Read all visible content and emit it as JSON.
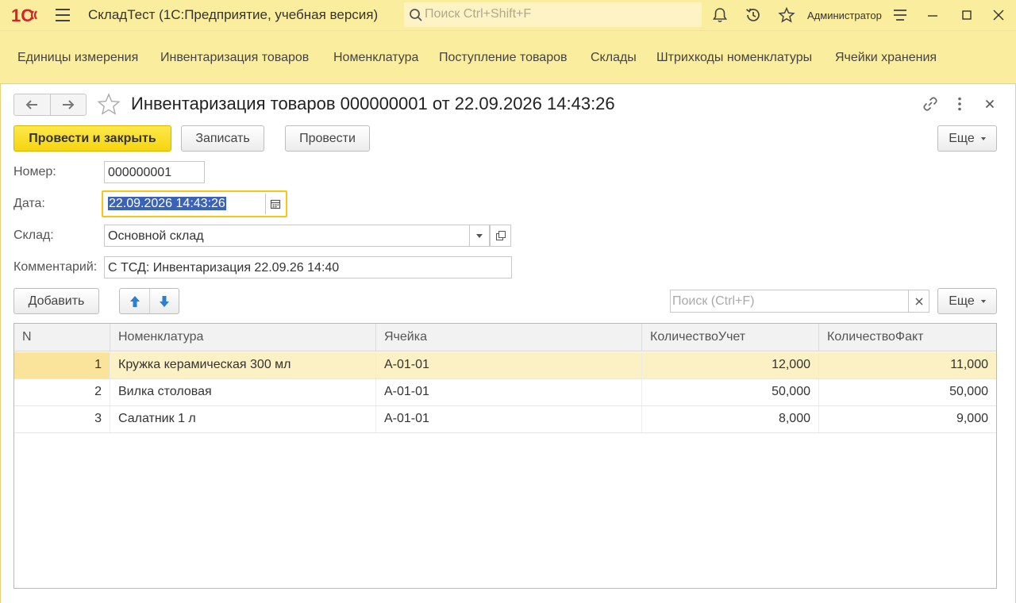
{
  "app": {
    "title": "СкладТест  (1С:Предприятие, учебная версия)",
    "search_placeholder": "Поиск Ctrl+Shift+F",
    "user": "Администратор",
    "logo_text": "1С"
  },
  "sections": [
    {
      "label": "Единицы измерения"
    },
    {
      "label": "Инвентаризация товаров"
    },
    {
      "label": "Номенклатура"
    },
    {
      "label": "Поступление товаров"
    },
    {
      "label": "Склады"
    },
    {
      "label": "Штрихкоды номенклатуры"
    },
    {
      "label": "Ячейки хранения"
    }
  ],
  "form": {
    "title": "Инвентаризация товаров 000000001 от 22.09.2026 14:43:26",
    "buttons": {
      "post_close": "Провести и закрыть",
      "save": "Записать",
      "post": "Провести",
      "more": "Еще"
    },
    "fields": {
      "number_label": "Номер:",
      "number_value": "000000001",
      "date_label": "Дата:",
      "date_value": "22.09.2026 14:43:26",
      "warehouse_label": "Склад:",
      "warehouse_value": "Основной склад",
      "comment_label": "Комментарий:",
      "comment_value": "С ТСД: Инвентаризация 22.09.26 14:40"
    },
    "table_toolbar": {
      "add": "Добавить",
      "search_placeholder": "Поиск (Ctrl+F)",
      "more": "Еще"
    },
    "table": {
      "columns": [
        "N",
        "Номенклатура",
        "Ячейка",
        "КоличествоУчет",
        "КоличествоФакт"
      ],
      "rows": [
        {
          "n": "1",
          "item": "Кружка керамическая 300 мл",
          "cell": "А-01-01",
          "qty_acc": "12,000",
          "qty_fact": "11,000",
          "selected": true
        },
        {
          "n": "2",
          "item": "Вилка столовая",
          "cell": "А-01-01",
          "qty_acc": "50,000",
          "qty_fact": "50,000",
          "selected": false
        },
        {
          "n": "3",
          "item": "Салатник 1 л",
          "cell": "А-01-01",
          "qty_acc": "8,000",
          "qty_fact": "9,000",
          "selected": false
        }
      ]
    }
  },
  "colors": {
    "accent_yellow": "#fbed9e",
    "primary_button": "#f6d40f",
    "logo_red": "#d6232a",
    "selection_blue": "#3a63b8",
    "arrow_blue": "#2d7fd1"
  },
  "icons": [
    "menu-icon",
    "search-icon",
    "bell-icon",
    "history-icon",
    "star-icon",
    "settings-icon",
    "minimize-icon",
    "maximize-icon",
    "close-icon",
    "back-arrow-icon",
    "forward-arrow-icon",
    "favorite-star-icon",
    "link-icon",
    "kebab-menu-icon",
    "calendar-icon",
    "dropdown-arrow-icon",
    "open-icon",
    "move-up-icon",
    "move-down-icon",
    "clear-icon"
  ]
}
